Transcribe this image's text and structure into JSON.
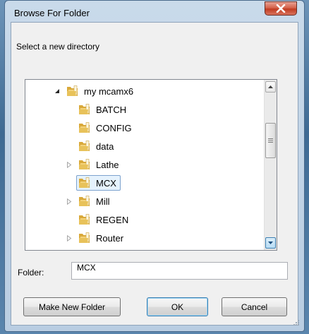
{
  "window": {
    "title": "Browse For Folder"
  },
  "dialog": {
    "description": "Select a new directory"
  },
  "tree": {
    "items": [
      {
        "label": "my mcamx6",
        "indent": 0,
        "expander": "expanded",
        "selected": false
      },
      {
        "label": "BATCH",
        "indent": 1,
        "expander": "none",
        "selected": false
      },
      {
        "label": "CONFIG",
        "indent": 1,
        "expander": "none",
        "selected": false
      },
      {
        "label": "data",
        "indent": 1,
        "expander": "none",
        "selected": false
      },
      {
        "label": "Lathe",
        "indent": 1,
        "expander": "collapsed",
        "selected": false
      },
      {
        "label": "MCX",
        "indent": 1,
        "expander": "none",
        "selected": true
      },
      {
        "label": "Mill",
        "indent": 1,
        "expander": "collapsed",
        "selected": false
      },
      {
        "label": "REGEN",
        "indent": 1,
        "expander": "none",
        "selected": false
      },
      {
        "label": "Router",
        "indent": 1,
        "expander": "collapsed",
        "selected": false
      }
    ]
  },
  "folder": {
    "label": "Folder:",
    "value": "MCX"
  },
  "buttons": {
    "make_new_folder": "Make New Folder",
    "ok": "OK",
    "cancel": "Cancel"
  },
  "colors": {
    "selection_bg": "#e5f2fd",
    "selection_border": "#7da2ce",
    "folder_yellow": "#e8c25a",
    "close_red": "#c13c22"
  },
  "icons": {
    "close": "close-icon",
    "folder": "folder-icon",
    "expanded": "expanded-triangle-icon",
    "collapsed": "collapsed-triangle-icon"
  }
}
